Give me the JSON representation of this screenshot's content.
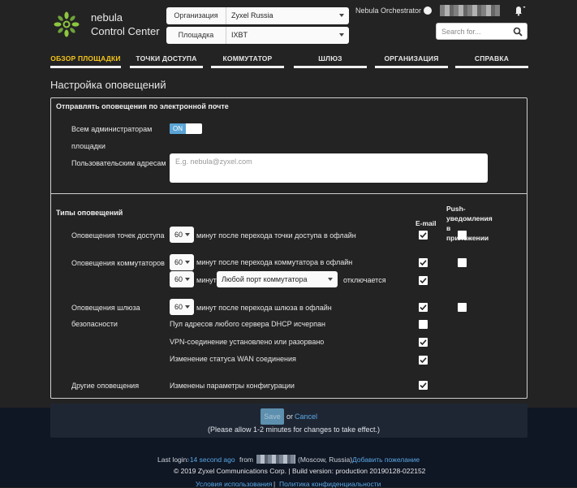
{
  "header": {
    "brand_line1": "nebula",
    "brand_line2": "Control Center",
    "org_label": "Организация",
    "org_value": "Zyxel Russia",
    "site_label": "Площадка",
    "site_value": "IXBT",
    "orchestrator": "Nebula Orchestrator",
    "search_placeholder": "Search for..."
  },
  "nav": [
    {
      "label": "ОБЗОР ПЛОЩАДКИ",
      "active": true
    },
    {
      "label": "ТОЧКИ ДОСТУПА"
    },
    {
      "label": "КОММУТАТОР"
    },
    {
      "label": "ШЛЮЗ"
    },
    {
      "label": "ОРГАНИЗАЦИЯ"
    },
    {
      "label": "СПРАВКА"
    }
  ],
  "page_title": "Настройка оповещений",
  "email_section": {
    "title": "Отправлять оповещения по электронной почте",
    "all_admins_label_1": "Всем администраторам",
    "all_admins_label_2": "площадки",
    "toggle_on": "ON",
    "custom_label": "Пользовательским адресам",
    "custom_placeholder": "E.g. nebula@zyxel.com"
  },
  "types_section": {
    "title": "Типы оповещений",
    "col_email": "E-mail",
    "col_push_1": "Push-",
    "col_push_2": "уведомления",
    "col_push_3": "в",
    "col_push_4": "приложении",
    "ap_label": "Оповещения точек доступа",
    "ap_minutes": "60",
    "ap_text": "минут после перехода точки доступа в офлайн",
    "sw_label": "Оповещения коммутаторов",
    "sw_minutes": "60",
    "sw_text": "минут после перехода коммутатора в офлайн",
    "sw2_minutes": "60",
    "sw2_text": "минут",
    "port_value": "Любой порт коммутатора",
    "disconnect_text": "отключается",
    "gw_label_1": "Оповещения шлюза",
    "gw_label_2": "безопасности",
    "gw_minutes": "60",
    "gw_text": "минут после перехода шлюза в офлайн",
    "dhcp_text": "Пул адресов любого сервера DHCP исчерпан",
    "vpn_text": "VPN-соединение установлено или разорвано",
    "wan_text": "Изменение статуса WAN соединения",
    "other_label": "Другие оповещения",
    "config_text": "Изменены параметры конфигурации"
  },
  "checkboxes": {
    "ap_email": true,
    "ap_push": false,
    "sw_email": true,
    "sw_push": false,
    "sw2_email": true,
    "gw_email": true,
    "gw_push": false,
    "dhcp_email": false,
    "vpn_email": true,
    "wan_email": true,
    "config_email": true
  },
  "footer": {
    "save": "Save",
    "or": "or",
    "cancel": "Cancel",
    "allow": "(Please allow 1-2 minutes for changes to take effect.)",
    "last_login": "Last login:",
    "last_login_ago": "-14 second ago",
    "from": "from",
    "location": "(Moscow, Russia).",
    "add_wish": "Добавить пожелание",
    "copyright": "© 2019 Zyxel Communications Corp. | Build version: production 20190128-022152",
    "terms": "Условия использования",
    "sep": "|",
    "privacy": "Политика конфиденциальности"
  },
  "colors": {
    "background": "#232323",
    "active_nav": "#f5c518",
    "link": "#5aa9e6",
    "toggle_on": "#5aa4d6",
    "footer": "#0f1624"
  }
}
